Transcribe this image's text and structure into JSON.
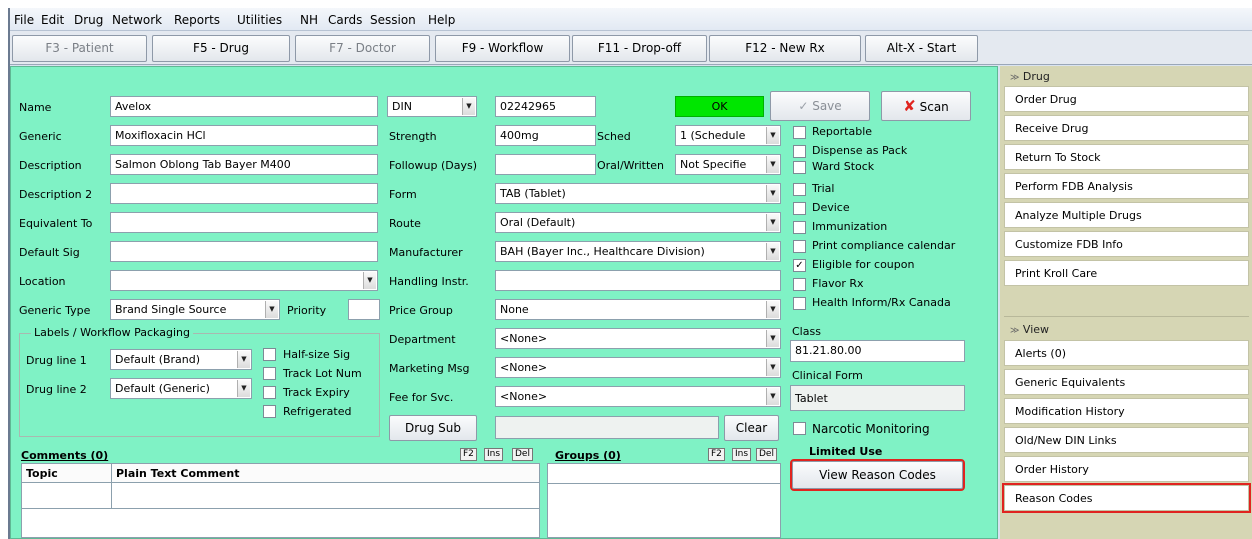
{
  "menu": [
    "File",
    "Edit",
    "Drug",
    "Network",
    "Reports",
    "Utilities",
    "NH",
    "Cards",
    "Session",
    "Help"
  ],
  "toolbar": {
    "patient": "F3 - Patient",
    "drug": "F5 - Drug",
    "doctor": "F7 - Doctor",
    "workflow": "F9 - Workflow",
    "dropoff": "F11 - Drop-off",
    "newrx": "F12 - New Rx",
    "start": "Alt-X - Start"
  },
  "form": {
    "name_label": "Name",
    "name_value": "Avelox",
    "generic_label": "Generic",
    "generic_value": "Moxifloxacin HCl",
    "description_label": "Description",
    "description_value": "Salmon Oblong Tab Bayer M400",
    "description2_label": "Description 2",
    "description2_value": "",
    "equivalent_label": "Equivalent To",
    "equivalent_value": "",
    "default_sig_label": "Default Sig",
    "default_sig_value": "",
    "location_label": "Location",
    "location_value": "",
    "generic_type_label": "Generic Type",
    "generic_type_value": "Brand Single Source",
    "priority_label": "Priority",
    "priority_value": "",
    "din_type": "DIN",
    "din_value": "02242965",
    "din_status": "OK",
    "strength_label": "Strength",
    "strength_value": "400mg",
    "sched_label": "Sched",
    "sched_value": "1 (Schedule",
    "followup_label": "Followup (Days)",
    "followup_value": "",
    "oral_label": "Oral/Written",
    "oral_value": "Not Specifie",
    "form_label": "Form",
    "form_value": "TAB (Tablet)",
    "route_label": "Route",
    "route_value": "Oral (Default)",
    "manufacturer_label": "Manufacturer",
    "manufacturer_value": "BAH (Bayer Inc., Healthcare Division)",
    "handling_label": "Handling Instr.",
    "handling_value": "",
    "price_group_label": "Price Group",
    "price_group_value": "None",
    "department_label": "Department",
    "department_value": "<None>",
    "marketing_label": "Marketing Msg",
    "marketing_value": "<None>",
    "fee_label": "Fee for Svc.",
    "fee_value": "<None>",
    "drug_sub_label": "Drug Sub",
    "drug_sub_value": "",
    "clear_label": "Clear",
    "save_label": "Save",
    "scan_label": "Scan"
  },
  "labels_group": {
    "title": "Labels / Workflow Packaging",
    "line1_label": "Drug line 1",
    "line1_value": "Default (Brand)",
    "line2_label": "Drug line 2",
    "line2_value": "Default (Generic)",
    "half_size": "Half-size Sig",
    "track_lot": "Track Lot Num",
    "track_expiry": "Track Expiry",
    "refrigerated": "Refrigerated"
  },
  "checkboxes": [
    {
      "label": "Reportable",
      "checked": false
    },
    {
      "label": "Dispense as Pack",
      "checked": false
    },
    {
      "label": "Ward Stock",
      "checked": false
    },
    {
      "label": "Trial",
      "checked": false
    },
    {
      "label": "Device",
      "checked": false
    },
    {
      "label": "Immunization",
      "checked": false
    },
    {
      "label": "Print compliance calendar",
      "checked": false
    },
    {
      "label": "Eligible for coupon",
      "checked": true
    },
    {
      "label": "Flavor Rx",
      "checked": false
    },
    {
      "label": "Health Inform/Rx Canada",
      "checked": false
    }
  ],
  "class_label": "Class",
  "class_value": "81.21.80.00",
  "clinical_label": "Clinical Form",
  "clinical_value": "Tablet",
  "narcotic_label": "Narcotic Monitoring",
  "limited_use_label": "Limited Use",
  "view_reason_label": "View Reason Codes",
  "comments": {
    "title": "Comments (0)",
    "col_topic": "Topic",
    "col_comment": "Plain Text Comment"
  },
  "groups": {
    "title": "Groups (0)"
  },
  "mini_buttons": {
    "f2": "F2",
    "ins": "Ins",
    "del": "Del"
  },
  "side_drug": {
    "title": "Drug",
    "items": [
      "Order Drug",
      "Receive Drug",
      "Return To Stock",
      "Perform FDB Analysis",
      "Analyze Multiple Drugs",
      "Customize FDB Info",
      "Print Kroll Care"
    ]
  },
  "side_view": {
    "title": "View",
    "items": [
      "Alerts (0)",
      "Generic Equivalents",
      "Modification History",
      "Old/New DIN Links",
      "Order History",
      "Reason Codes"
    ]
  },
  "colors": {
    "form_bg": "#7ff2c5",
    "ok_green": "#00e600",
    "highlight_red": "#e0241f",
    "side_bg": "#d6d6b4"
  }
}
